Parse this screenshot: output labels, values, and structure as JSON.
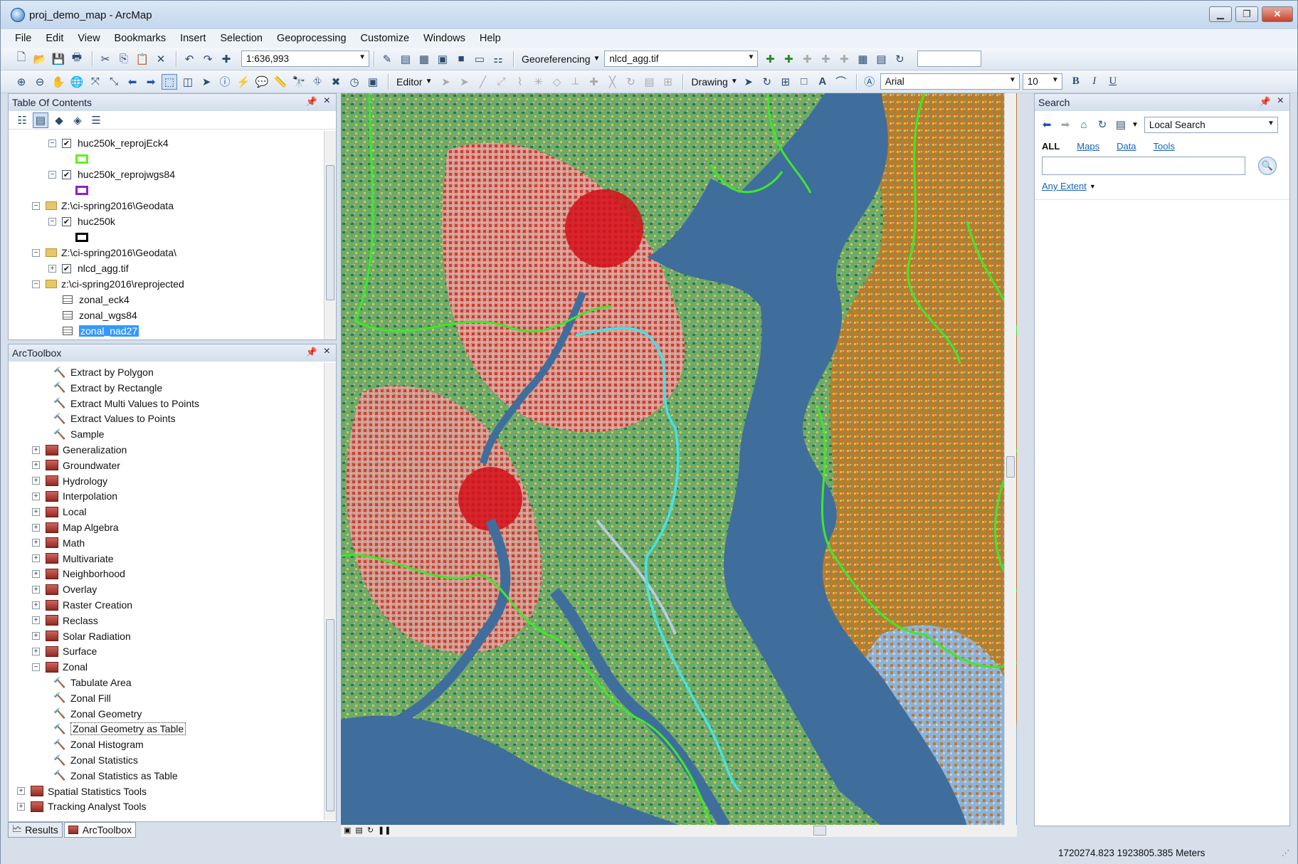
{
  "window": {
    "title": "proj_demo_map - ArcMap"
  },
  "menu": [
    "File",
    "Edit",
    "View",
    "Bookmarks",
    "Insert",
    "Selection",
    "Geoprocessing",
    "Customize",
    "Windows",
    "Help"
  ],
  "toolbar": {
    "scale": "1:636,993",
    "georeferencing_label": "Georeferencing",
    "layer_combo": "nlcd_agg.tif",
    "editor_label": "Editor",
    "drawing_label": "Drawing",
    "font_name": "Arial",
    "font_size": "10",
    "bold": "B",
    "italic": "I",
    "underline": "U"
  },
  "toc": {
    "title": "Table Of Contents",
    "items": [
      {
        "label": "huc250k_reprojEck4",
        "swatch": "#66ee22"
      },
      {
        "label": "huc250k_reprojwgs84",
        "swatch": "#8a22cc"
      },
      {
        "label": "Z:\\ci-spring2016\\Geodata"
      },
      {
        "label": "huc250k",
        "swatch": "#000000"
      },
      {
        "label": "Z:\\ci-spring2016\\Geodata\\"
      },
      {
        "label": "nlcd_agg.tif"
      },
      {
        "label": "z:\\ci-spring2016\\reprojected"
      },
      {
        "label": "zonal_eck4"
      },
      {
        "label": "zonal_wgs84"
      },
      {
        "label": "zonal_nad27"
      }
    ]
  },
  "toolbox": {
    "title": "ArcToolbox",
    "items": [
      "Extract by Polygon",
      "Extract by Rectangle",
      "Extract Multi Values to Points",
      "Extract Values to Points",
      "Sample",
      "Generalization",
      "Groundwater",
      "Hydrology",
      "Interpolation",
      "Local",
      "Map Algebra",
      "Math",
      "Multivariate",
      "Neighborhood",
      "Overlay",
      "Raster Creation",
      "Reclass",
      "Solar Radiation",
      "Surface",
      "Zonal",
      "Tabulate Area",
      "Zonal Fill",
      "Zonal Geometry",
      "Zonal Geometry as Table",
      "Zonal Histogram",
      "Zonal Statistics",
      "Zonal Statistics as Table",
      "Spatial Statistics Tools",
      "Tracking Analyst Tools"
    ]
  },
  "tabs": {
    "results": "Results",
    "arctoolbox": "ArcToolbox"
  },
  "search": {
    "title": "Search",
    "scope": "Local Search",
    "filters": {
      "all": "ALL",
      "maps": "Maps",
      "data": "Data",
      "tools": "Tools"
    },
    "input_value": "",
    "extent": "Any Extent"
  },
  "status": {
    "coords": "1720274.823  1923805.385 Meters"
  }
}
